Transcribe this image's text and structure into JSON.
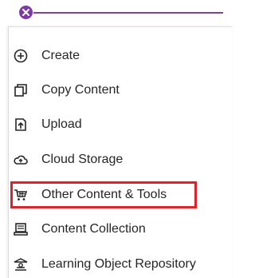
{
  "close_button": {
    "icon": "close-x-icon",
    "color": "#7d3aa6"
  },
  "accent_line_color": "#8c3aa4",
  "highlight_color": "#e0202a",
  "menu": {
    "items": [
      {
        "label": "Create",
        "icon": "plus-circle-icon"
      },
      {
        "label": "Copy Content",
        "icon": "copy-icon"
      },
      {
        "label": "Upload",
        "icon": "upload-icon"
      },
      {
        "label": "Cloud Storage",
        "icon": "cloud-upload-icon"
      },
      {
        "label": "Other Content & Tools",
        "icon": "cart-tools-icon",
        "highlighted": true
      },
      {
        "label": "Content Collection",
        "icon": "content-collection-icon"
      },
      {
        "label": "Learning Object Repository",
        "icon": "repository-icon"
      }
    ]
  }
}
